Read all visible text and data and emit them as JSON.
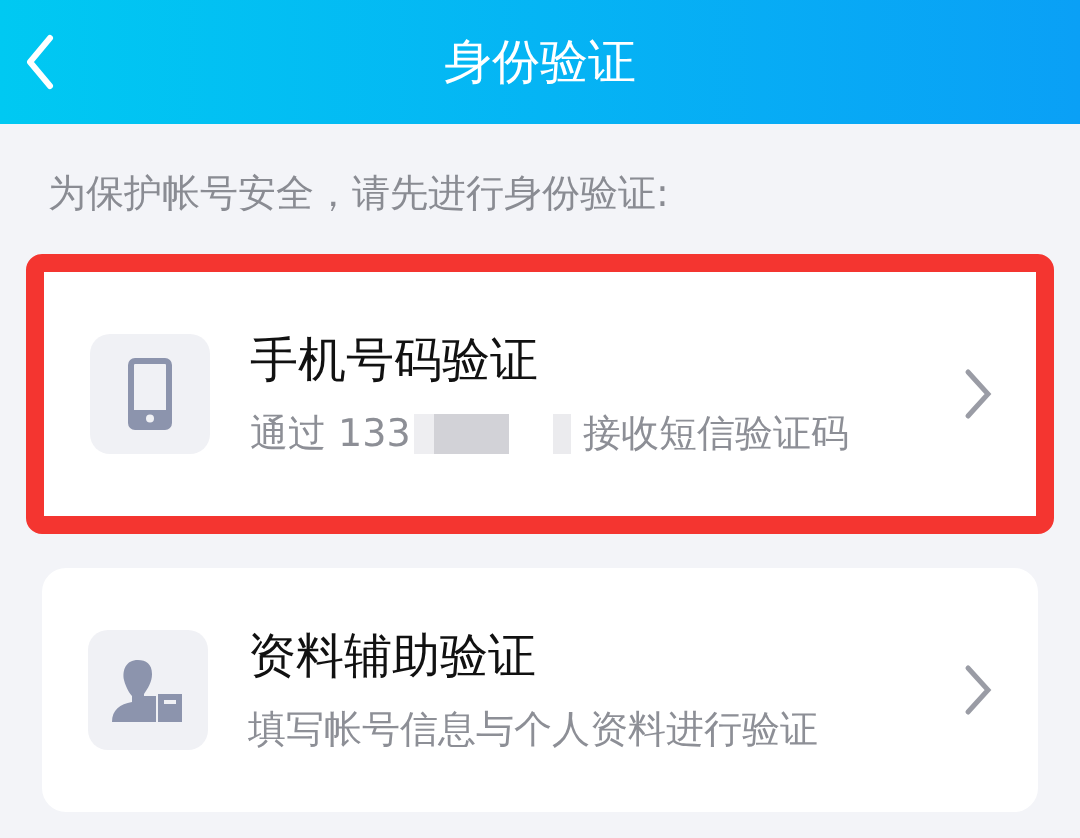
{
  "header": {
    "title": "身份验证"
  },
  "hint": "为保护帐号安全，请先进行身份验证:",
  "options": [
    {
      "kind": "phone",
      "title": "手机号码验证",
      "subtitle_prefix": "通过 133",
      "redacted": true,
      "subtitle_suffix": "接收短信验证码",
      "highlighted": true
    },
    {
      "kind": "profile",
      "title": "资料辅助验证",
      "subtitle_prefix": "填写帐号信息与个人资料进行验证",
      "redacted": false,
      "highlighted": false
    }
  ]
}
